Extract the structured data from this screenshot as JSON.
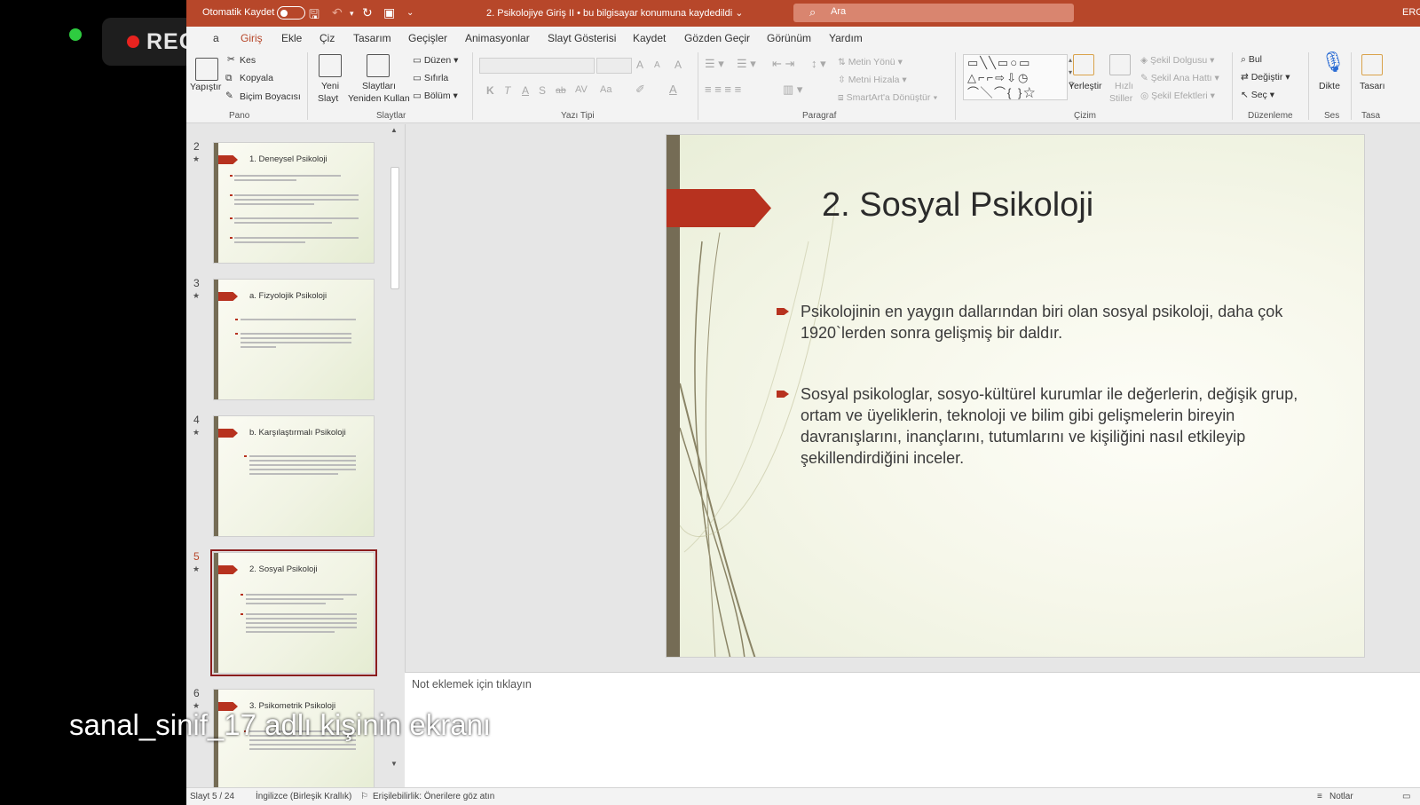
{
  "meeting": {
    "rec_label": "REC",
    "share_caption": "sanal_sinif_17 adlı kişinin ekranı"
  },
  "titlebar": {
    "autosave_label": "Otomatik Kaydet",
    "doc_title": "2. Psikolojiye Giriş II  •  bu bilgisayar konumuna kaydedildi ⌄",
    "search_placeholder": "Ara",
    "user_initials": "ERG"
  },
  "menu": {
    "items": [
      "a",
      "Giriş",
      "Ekle",
      "Çiz",
      "Tasarım",
      "Geçişler",
      "Animasyonlar",
      "Slayt Gösterisi",
      "Kaydet",
      "Gözden Geçir",
      "Görünüm",
      "Yardım"
    ],
    "active": "Giriş"
  },
  "ribbon": {
    "clipboard": {
      "paste": "Yapıştır",
      "cut": "Kes",
      "copy": "Kopyala",
      "format_painter": "Biçim Boyacısı",
      "group": "Pano"
    },
    "slides": {
      "new_slide_1": "Yeni",
      "new_slide_2": "Slayt",
      "reuse_1": "Slaytları",
      "reuse_2": "Yeniden Kullan",
      "layout": "Düzen",
      "reset": "Sıfırla",
      "section": "Bölüm",
      "group": "Slaytlar"
    },
    "font": {
      "bold": "K",
      "italic": "T",
      "underline": "A",
      "shadow": "S",
      "strike": "ab",
      "spacing": "AV",
      "case": "Aa",
      "grow": "A",
      "shrink": "A",
      "clear": "A",
      "group": "Yazı Tipi"
    },
    "paragraph": {
      "text_direction": "Metin Yönü",
      "align_text": "Metni Hizala",
      "smartart": "SmartArt'a Dönüştür",
      "group": "Paragraf"
    },
    "drawing": {
      "arrange": "Yerleştir",
      "quick_styles_1": "Hızlı",
      "quick_styles_2": "Stiller",
      "shape_fill": "Şekil Dolgusu",
      "shape_outline": "Şekil Ana Hattı",
      "shape_effects": "Şekil Efektleri",
      "group": "Çizim"
    },
    "editing": {
      "find": "Bul",
      "replace": "Değiştir",
      "select": "Seç",
      "group": "Düzenleme"
    },
    "voice": {
      "dictate": "Dikte",
      "group": "Ses"
    },
    "designer": {
      "label": "Tasarı",
      "group": "Tasa"
    }
  },
  "thumbnails": [
    {
      "num": "2",
      "title": "1. Deneysel Psikoloji",
      "selected": false
    },
    {
      "num": "3",
      "title": "a. Fizyolojik Psikoloji",
      "selected": false
    },
    {
      "num": "4",
      "title": "b. Karşılaştırmalı Psikoloji",
      "selected": false
    },
    {
      "num": "5",
      "title": "2. Sosyal Psikoloji",
      "selected": true
    },
    {
      "num": "6",
      "title": "3. Psikometrik Psikoloji",
      "selected": false
    }
  ],
  "slide": {
    "title": "2. Sosyal Psikoloji",
    "bullets": [
      "Psikolojinin en yaygın dallarından biri olan sosyal psikoloji, daha çok 1920`lerden sonra gelişmiş bir daldır.",
      "Sosyal psikologlar, sosyo-kültürel kurumlar ile değerlerin, değişik grup, ortam ve üyeliklerin, teknoloji ve bilim gibi gelişmelerin bireyin davranışlarını, inançlarını, tutumlarını ve kişiliğini nasıl etkileyip şekillendirdiğini inceler."
    ]
  },
  "notes": {
    "placeholder": "Not eklemek için tıklayın"
  },
  "statusbar": {
    "slide_info": "Slayt 5 / 24",
    "language": "İngilizce (Birleşik Krallık)",
    "accessibility": "Erişilebilirlik: Önerilere göz atın",
    "notes_button": "Notlar"
  },
  "colors": {
    "accent": "#b7472a",
    "slide_arrow": "#b7321f",
    "slide_bar": "#756c55",
    "rec_dot": "#e8231f",
    "status_dot": "#2ecc40"
  }
}
